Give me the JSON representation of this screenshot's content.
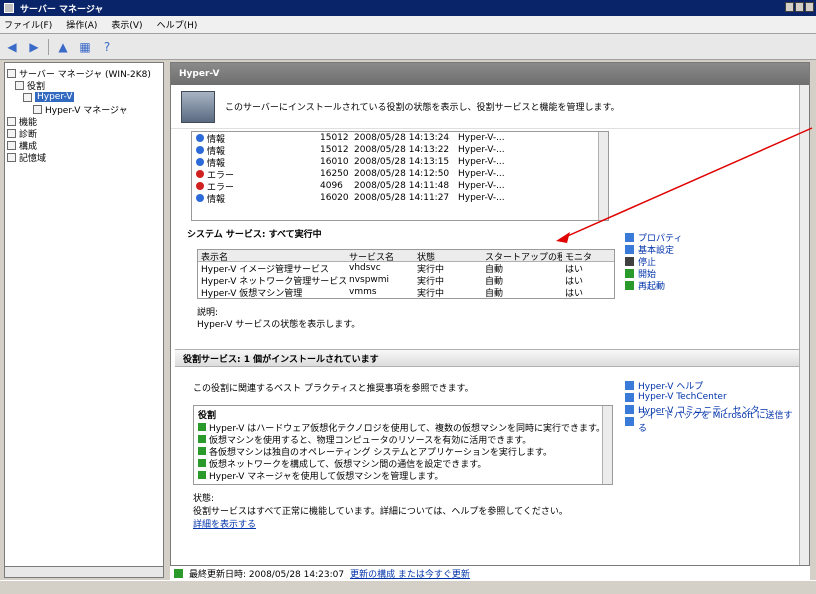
{
  "window": {
    "title": "サーバー マネージャ"
  },
  "menu": {
    "items": [
      "ファイル(F)",
      "操作(A)",
      "表示(V)",
      "ヘルプ(H)"
    ]
  },
  "tree": {
    "items": [
      {
        "label": "サーバー マネージャ (WIN-2K8)",
        "level": 0
      },
      {
        "label": "役割",
        "level": 1
      },
      {
        "label": "Hyper-V",
        "level": 2,
        "selected": true
      },
      {
        "label": "Hyper-V マネージャ",
        "level": 3
      },
      {
        "label": "機能",
        "level": 0
      },
      {
        "label": "診断",
        "level": 0
      },
      {
        "label": "構成",
        "level": 0
      },
      {
        "label": "記憶域",
        "level": 0
      }
    ]
  },
  "main": {
    "header": "Hyper-V",
    "intro_text": "このサーバーにインストールされている役割の状態を表示し、役割サービスと機能を管理します。",
    "events": [
      {
        "type": "info",
        "level": "情報",
        "id": "15012",
        "date": "2008/05/28 14:13:24",
        "source": "Hyper-V-..."
      },
      {
        "type": "info",
        "level": "情報",
        "id": "15012",
        "date": "2008/05/28 14:13:22",
        "source": "Hyper-V-..."
      },
      {
        "type": "info",
        "level": "情報",
        "id": "16010",
        "date": "2008/05/28 14:13:15",
        "source": "Hyper-V-..."
      },
      {
        "type": "error",
        "level": "エラー",
        "id": "16250",
        "date": "2008/05/28 14:12:50",
        "source": "Hyper-V-..."
      },
      {
        "type": "error",
        "level": "エラー",
        "id": "4096",
        "date": "2008/05/28 14:11:48",
        "source": "Hyper-V-..."
      },
      {
        "type": "info",
        "level": "情報",
        "id": "16020",
        "date": "2008/05/28 14:11:27",
        "source": "Hyper-V-..."
      }
    ],
    "services_title": "システム サービス: すべて実行中",
    "services_cols": [
      "表示名",
      "サービス名",
      "状態",
      "スタートアップの種類",
      "モニタ"
    ],
    "services": [
      {
        "display": "Hyper-V イメージ管理サービス",
        "name": "vhdsvc",
        "status": "実行中",
        "startup": "自動",
        "monitor": "はい"
      },
      {
        "display": "Hyper-V ネットワーク管理サービス",
        "name": "nvspwmi",
        "status": "実行中",
        "startup": "自動",
        "monitor": "はい"
      },
      {
        "display": "Hyper-V 仮想マシン管理",
        "name": "vmms",
        "status": "実行中",
        "startup": "自動",
        "monitor": "はい"
      }
    ],
    "services_desc_label": "説明:",
    "services_desc": "Hyper-V サービスの状態を表示します。",
    "services_actions": [
      "プロパティ",
      "基本設定",
      "停止",
      "開始",
      "再起動"
    ],
    "role_section": "役割サービス: 1 個がインストールされています",
    "role_intro": "この役割に関連するベスト プラクティスと推奨事項を参照できます。",
    "role_box_header": "役割",
    "role_lines": [
      "Hyper-V はハードウェア仮想化テクノロジを使用して、複数の仮想マシンを同時に実行できます。",
      "仮想マシンを使用すると、物理コンピュータのリソースを有効に活用できます。",
      "各仮想マシンは独自のオペレーティング システムとアプリケーションを実行します。",
      "仮想ネットワークを構成して、仮想マシン間の通信を設定できます。",
      "Hyper-V マネージャを使用して仮想マシンを管理します。"
    ],
    "role_actions": [
      "Hyper-V ヘルプ",
      "Hyper-V TechCenter",
      "Hyper-V コミュニティ センター",
      "フィードバックを Microsoft に送信する"
    ],
    "status_label": "状態:",
    "status_text": "役割サービスはすべて正常に機能しています。詳細については、ヘルプを参照してください。",
    "status_link": "詳細を表示する"
  },
  "footer": {
    "refresh_text": "最終更新日時: 2008/05/28 14:23:07",
    "refresh_link": "更新の構成 または今すぐ更新"
  }
}
